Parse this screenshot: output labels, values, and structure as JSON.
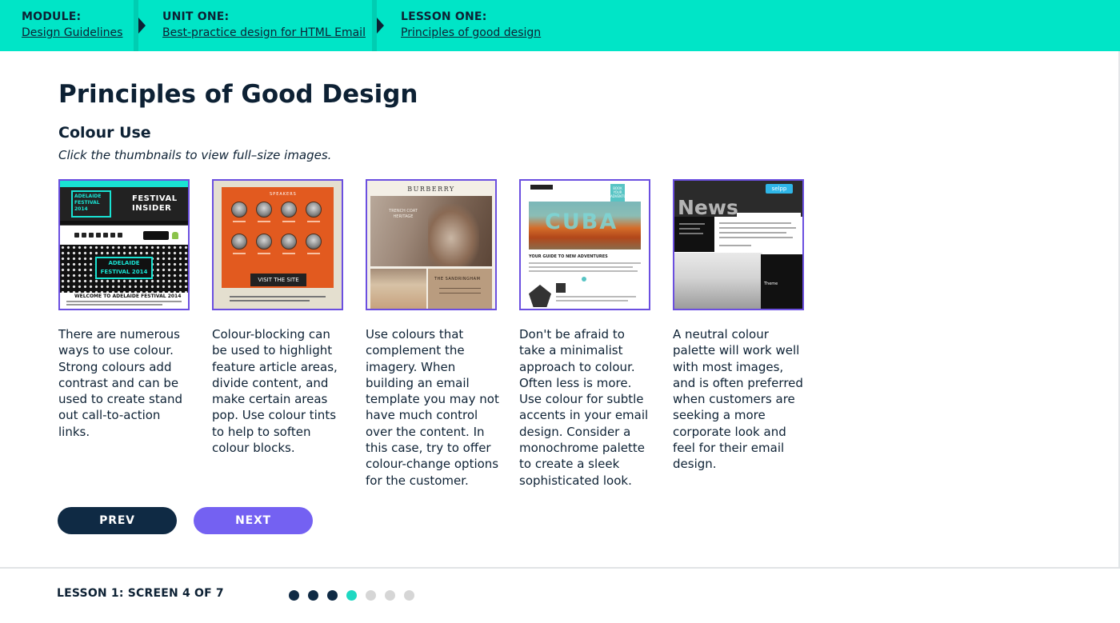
{
  "breadcrumb": {
    "module": {
      "label": "MODULE:",
      "value": "Design Guidelines"
    },
    "unit": {
      "label": "UNIT ONE:",
      "value": "Best-practice design for HTML Email"
    },
    "lesson": {
      "label": "LESSON ONE:",
      "value": "Principles of good design"
    }
  },
  "page": {
    "title": "Principles of Good Design",
    "subtitle": "Colour Use",
    "hint": "Click the thumbnails to view full–size images."
  },
  "thumbnails": [
    {
      "icon": "email-thumbnail-adelaide-festival",
      "text": {
        "logo": "ADELAIDE FESTIVAL 2014",
        "heading": "FESTIVAL INSIDER",
        "badge": "ADELAIDE FESTIVAL 2014",
        "welcome": "WELCOME TO ADELAIDE FESTIVAL 2014"
      },
      "description": "There are numerous ways to use colour. Strong colours add contrast and can be used to create stand out call-to-action links."
    },
    {
      "icon": "email-thumbnail-speakers",
      "text": {
        "label": "SPEAKERS",
        "button": "VISIT THE SITE"
      },
      "description": "Colour-blocking can be used to highlight feature article areas, divide content, and make certain areas pop. Use colour tints to help to soften colour blocks."
    },
    {
      "icon": "email-thumbnail-burberry",
      "text": {
        "brand": "BURBERRY",
        "hero": "TRENCH COAT HERITAGE",
        "side": "THE SANDRINGHAM"
      },
      "description": "Use colours that complement the imagery. When building an email template you may not have much control over the content. In this case, try to offer colour-change options for the customer."
    },
    {
      "icon": "email-thumbnail-cuba",
      "text": {
        "tag": "BOOK YOUR ADVENTURE",
        "photo": "CUBA",
        "headline": "YOUR GUIDE TO NEW ADVENTURES"
      },
      "description": "Don't be afraid to take a minimalist approach to colour. Often less is more. Use colour for subtle accents in your email design. Consider a monochrome palette to create a sleek sophisticated look."
    },
    {
      "icon": "email-thumbnail-selpp-news",
      "text": {
        "brand": "selpp",
        "heading": "News",
        "panel": "Theme"
      },
      "description": "A neutral colour palette will work well with most images, and is often preferred when customers are seeking a more corporate look and feel for their email design."
    }
  ],
  "nav": {
    "prev": "PREV",
    "next": "NEXT"
  },
  "footer": {
    "progress_label": "LESSON 1: SCREEN 4 OF 7",
    "current_screen": 4,
    "total_screens": 7
  },
  "colors": {
    "accent_teal": "#00e5c7",
    "navy": "#0f2a44",
    "purple": "#7461f2",
    "dot_done": "#0f2a44",
    "dot_current": "#1ed8c2",
    "dot_pending": "#d6d6d6"
  }
}
